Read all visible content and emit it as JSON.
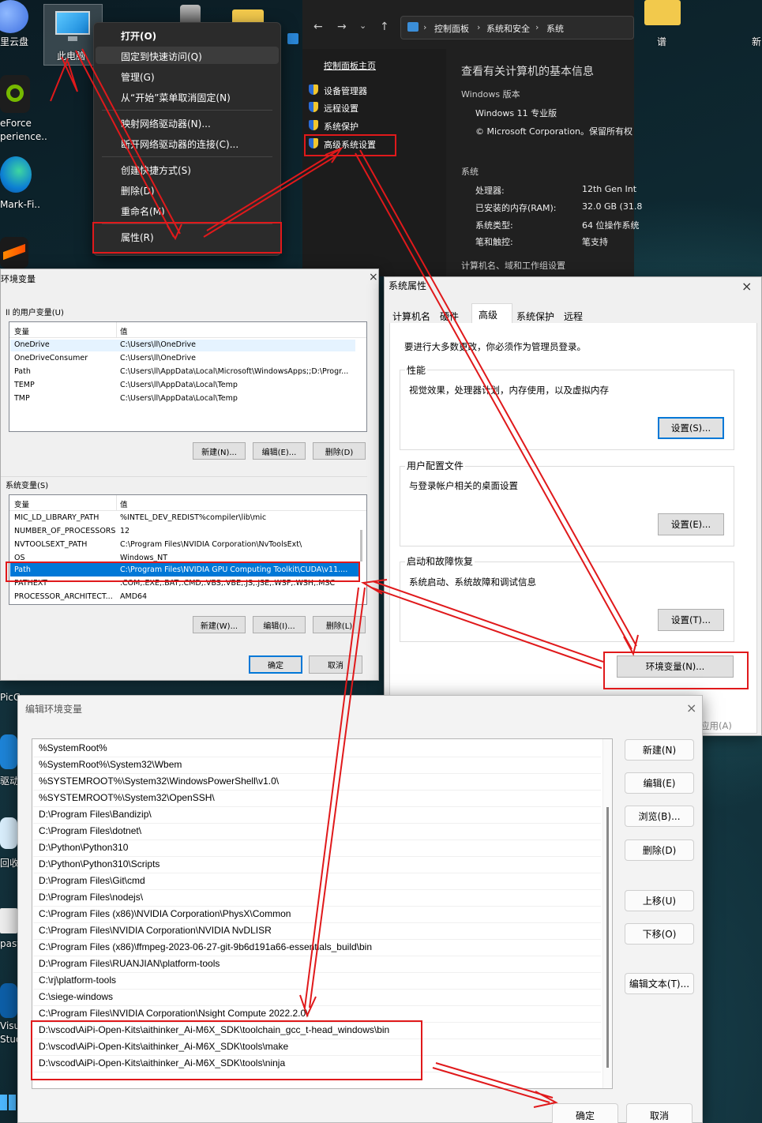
{
  "desktop": {
    "labels": [
      "里云盘",
      "eForce",
      "perience..",
      "Mark-Fi..",
      "PicG",
      "驱动",
      "回收",
      "past",
      "Visu",
      "Stud",
      "谱",
      "新"
    ],
    "this_pc_label": "此电脑"
  },
  "context_menu": {
    "items": [
      "打开(O)",
      "固定到快速访问(Q)",
      "管理(G)",
      "从“开始”菜单取消固定(N)",
      "映射网络驱动器(N)...",
      "断开网络驱动器的连接(C)...",
      "创建快捷方式(S)",
      "删除(D)",
      "重命名(M)",
      "属性(R)"
    ]
  },
  "control_panel": {
    "breadcrumb": [
      "控制面板",
      "系统和安全",
      "系统"
    ],
    "home_link": "控制面板主页",
    "links": [
      "设备管理器",
      "远程设置",
      "系统保护",
      "高级系统设置"
    ],
    "title": "查看有关计算机的基本信息",
    "edition_heading": "Windows 版本",
    "edition": "Windows 11 专业版",
    "copyright": "© Microsoft Corporation。保留所有权",
    "system_heading": "系统",
    "specs": [
      {
        "k": "处理器:",
        "v": "12th Gen Int"
      },
      {
        "k": "已安装的内存(RAM):",
        "v": "32.0 GB (31.8"
      },
      {
        "k": "系统类型:",
        "v": "64 位操作系统"
      },
      {
        "k": "笔和触控:",
        "v": "笔支持"
      }
    ],
    "domain_heading": "计算机名、域和工作组设置"
  },
  "env_vars": {
    "title": "环境变量",
    "user_group": "ll 的用户变量(U)",
    "col_var": "变量",
    "col_val": "值",
    "user_rows": [
      {
        "k": "OneDrive",
        "v": "C:\\Users\\ll\\OneDrive"
      },
      {
        "k": "OneDriveConsumer",
        "v": "C:\\Users\\ll\\OneDrive"
      },
      {
        "k": "Path",
        "v": "C:\\Users\\ll\\AppData\\Local\\Microsoft\\WindowsApps;;D:\\Progr..."
      },
      {
        "k": "TEMP",
        "v": "C:\\Users\\ll\\AppData\\Local\\Temp"
      },
      {
        "k": "TMP",
        "v": "C:\\Users\\ll\\AppData\\Local\\Temp"
      }
    ],
    "user_buttons": [
      "新建(N)...",
      "编辑(E)...",
      "删除(D)"
    ],
    "sys_group": "系统变量(S)",
    "sys_rows": [
      {
        "k": "MIC_LD_LIBRARY_PATH",
        "v": "%INTEL_DEV_REDIST%compiler\\lib\\mic"
      },
      {
        "k": "NUMBER_OF_PROCESSORS",
        "v": "12"
      },
      {
        "k": "NVTOOLSEXT_PATH",
        "v": "C:\\Program Files\\NVIDIA Corporation\\NvToolsExt\\"
      },
      {
        "k": "OS",
        "v": "Windows_NT"
      },
      {
        "k": "Path",
        "v": "C:\\Program Files\\NVIDIA GPU Computing Toolkit\\CUDA\\v11...."
      },
      {
        "k": "PATHEXT",
        "v": ".COM;.EXE;.BAT;.CMD;.VBS;.VBE;.JS;.JSE;.WSF;.WSH;.MSC"
      },
      {
        "k": "PROCESSOR_ARCHITECT...",
        "v": "AMD64"
      }
    ],
    "sys_buttons": [
      "新建(W)...",
      "编辑(I)...",
      "删除(L)"
    ],
    "ok": "确定",
    "cancel": "取消"
  },
  "sys_props": {
    "title": "系统属性",
    "tabs": [
      "计算机名",
      "硬件",
      "高级",
      "系统保护",
      "远程"
    ],
    "admin_note": "要进行大多数更改，你必须作为管理员登录。",
    "perf_title": "性能",
    "perf_desc": "视觉效果，处理器计划，内存使用，以及虚拟内存",
    "perf_btn": "设置(S)...",
    "profile_title": "用户配置文件",
    "profile_desc": "与登录帐户相关的桌面设置",
    "profile_btn": "设置(E)...",
    "startup_title": "启动和故障恢复",
    "startup_desc": "系统启动、系统故障和调试信息",
    "startup_btn": "设置(T)...",
    "env_btn": "环境变量(N)...",
    "apply": "应用(A)"
  },
  "edit_env": {
    "title": "编辑环境变量",
    "entries": [
      "%SystemRoot%",
      "%SystemRoot%\\System32\\Wbem",
      "%SYSTEMROOT%\\System32\\WindowsPowerShell\\v1.0\\",
      "%SYSTEMROOT%\\System32\\OpenSSH\\",
      "D:\\Program Files\\Bandizip\\",
      "C:\\Program Files\\dotnet\\",
      "D:\\Python\\Python310",
      "D:\\Python\\Python310\\Scripts",
      "D:\\Program Files\\Git\\cmd",
      "D:\\Program Files\\nodejs\\",
      "C:\\Program Files (x86)\\NVIDIA Corporation\\PhysX\\Common",
      "C:\\Program Files\\NVIDIA Corporation\\NVIDIA NvDLISR",
      "C:\\Program Files (x86)\\ffmpeg-2023-06-27-git-9b6d191a66-essentials_build\\bin",
      "D:\\Program Files\\RUANJIAN\\platform-tools",
      "C:\\rj\\platform-tools",
      "C:\\siege-windows",
      "C:\\Program Files\\NVIDIA Corporation\\Nsight Compute 2022.2.0\\",
      "D:\\vscod\\AiPi-Open-Kits\\aithinker_Ai-M6X_SDK\\toolchain_gcc_t-head_windows\\bin",
      "D:\\vscod\\AiPi-Open-Kits\\aithinker_Ai-M6X_SDK\\tools\\make",
      "D:\\vscod\\AiPi-Open-Kits\\aithinker_Ai-M6X_SDK\\tools\\ninja"
    ],
    "buttons": [
      "新建(N)",
      "编辑(E)",
      "浏览(B)...",
      "删除(D)",
      "上移(U)",
      "下移(O)",
      "编辑文本(T)..."
    ],
    "ok": "确定",
    "cancel": "取消"
  },
  "colors": {
    "annotation": "#e0191b",
    "selection": "#0078d7"
  }
}
